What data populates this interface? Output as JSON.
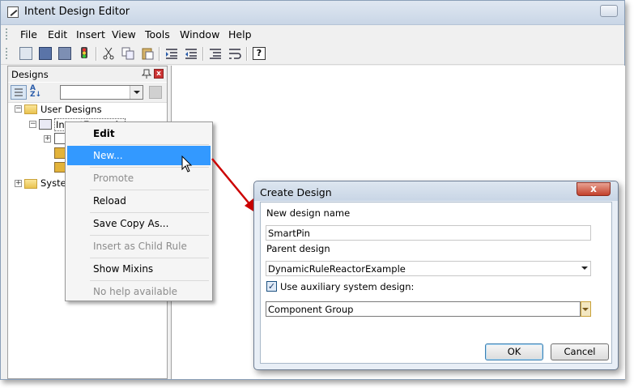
{
  "window": {
    "title": "Intent Design Editor"
  },
  "menubar": [
    "File",
    "Edit",
    "Insert",
    "View",
    "Tools",
    "Window",
    "Help"
  ],
  "left_pane": {
    "title": "Designs",
    "tree": {
      "user_designs": "User Designs",
      "intent_example": "IntentExample",
      "system": "Syste"
    }
  },
  "context_menu": {
    "items": [
      {
        "label": "Edit"
      },
      {
        "label": "New..."
      },
      {
        "label": "Promote"
      },
      {
        "label": "Reload"
      },
      {
        "label": "Save Copy As..."
      },
      {
        "label": "Insert as Child Rule"
      },
      {
        "label": "Show Mixins"
      },
      {
        "label": "No help available"
      }
    ]
  },
  "dialog": {
    "title": "Create Design",
    "close": "x",
    "new_design_name_label": "New design name",
    "new_design_name_value": "SmartPin",
    "parent_design_label": "Parent design",
    "parent_design_value": "DynamicRuleReactorExample",
    "aux_checkbox_label": "Use auxiliary system design:",
    "aux_checked": true,
    "aux_value": "Component Group",
    "ok": "OK",
    "cancel": "Cancel"
  },
  "colors": {
    "highlight": "#3399ff",
    "arrow": "#cc0000"
  }
}
